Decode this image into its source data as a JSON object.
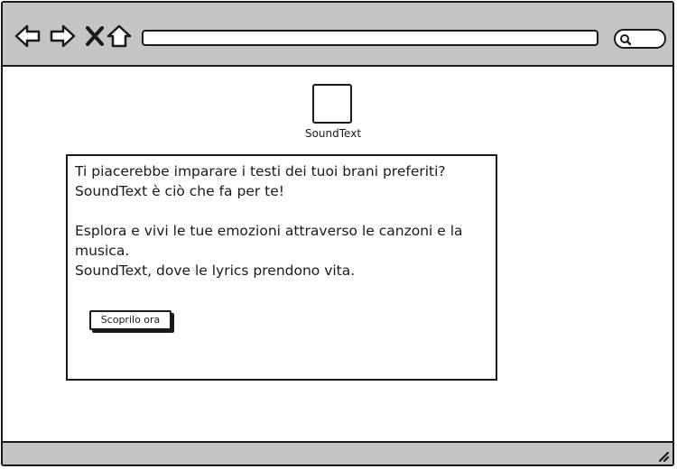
{
  "toolbar": {
    "icons": [
      "back-arrow-icon",
      "forward-arrow-icon",
      "close-icon",
      "home-icon"
    ],
    "address_value": "",
    "search_icon": "search-icon"
  },
  "logo": {
    "label": "SoundText"
  },
  "card": {
    "line1": "Ti piacerebbe imparare i testi dei tuoi brani preferiti?",
    "line2": "SoundText è ciò che fa per te!",
    "line3": "Esplora e vivi le tue emozioni attraverso le canzoni e la musica.",
    "line4": "SoundText, dove le lyrics prendono vita.",
    "button_label": "Scoprilo ora"
  },
  "colors": {
    "chrome": "#c4c4c4",
    "stroke": "#1a1a1a",
    "background": "#ffffff"
  }
}
